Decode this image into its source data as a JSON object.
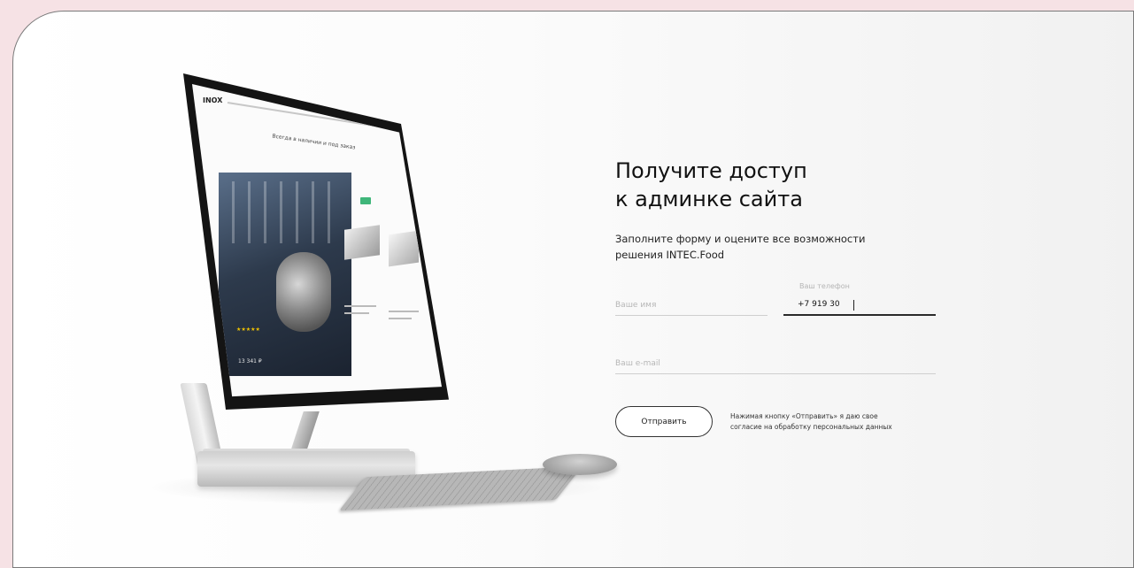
{
  "form": {
    "heading": "Получите доступ\nк админке сайта",
    "subtitle": "Заполните форму и оцените все возможности\nрешения INTEC.Food",
    "name_placeholder": "Ваше имя",
    "phone_label": "Ваш телефон",
    "phone_value": "+7 919 30",
    "email_placeholder": "Ваш e-mail",
    "submit_label": "Отправить",
    "consent_text": "Нажимая кнопку «Отправить» я даю свое\nсогласие на обработку персональных данных"
  },
  "illustration": {
    "screen_logo": "INOX",
    "screen_title": "Всегда в наличии и под заказ",
    "screen_stars": "★★★★★",
    "screen_price": "13 341 ₽"
  },
  "colors": {
    "page_background": "#f6e2e5",
    "card_background": "#ffffff",
    "text": "#111111",
    "field_line": "#cfcfcf",
    "active_field_line": "#2a2a2a"
  }
}
